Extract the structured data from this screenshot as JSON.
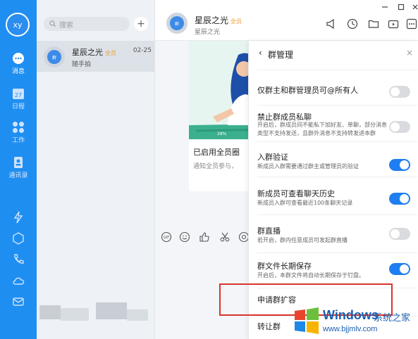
{
  "user": {
    "avatar_text": "xy"
  },
  "nav": [
    {
      "label": "消息",
      "icon": "chat-bubble-icon",
      "active": true
    },
    {
      "label": "日程",
      "icon": "calendar-icon",
      "day": "27"
    },
    {
      "label": "工作",
      "icon": "apps-grid-icon"
    },
    {
      "label": "通讯录",
      "icon": "contacts-icon"
    }
  ],
  "search": {
    "placeholder": "搜索"
  },
  "chat_list": [
    {
      "name": "星辰之光",
      "badge": "全员",
      "time": "02-25",
      "preview": "随手拍",
      "avatar_text": "群"
    }
  ],
  "conversation": {
    "title": "星辰之光",
    "badge": "全员",
    "subtitle": "星辰之光",
    "avatar_text": "群",
    "card": {
      "title": "已启用全员圈",
      "desc": "通知全员参与，"
    }
  },
  "panel": {
    "back": "‹",
    "title": "群管理",
    "close": "×",
    "settings": [
      {
        "name": "仅群主和群管理员可@所有人",
        "desc": "",
        "on": false
      },
      {
        "name": "禁止群成员私聊",
        "desc": "开启后，群成员间不能私下加好友、单聊，部分消息类型不支持发送，且群外消息不支持转发进本群",
        "on": false
      },
      {
        "name": "入群验证",
        "desc": "新成员入群需要通过群主或管理员的验证",
        "on": true
      },
      {
        "name": "新成员可查看聊天历史",
        "desc": "新成员入群可查看最近100条聊天记录",
        "on": true
      },
      {
        "name": "群直播",
        "desc": "若开启，群内任意成员可发起群直播",
        "on": false
      },
      {
        "name": "群文件长期保存",
        "desc": "开启后，本群文件将自动长期保存于钉盘。",
        "on": true
      },
      {
        "name": "申请群扩容",
        "desc": ""
      },
      {
        "name": "转让群",
        "desc": ""
      }
    ]
  },
  "watermark": {
    "brand": "Windows",
    "suffix": "系统之家",
    "url": "www.bjjmlv.com"
  }
}
